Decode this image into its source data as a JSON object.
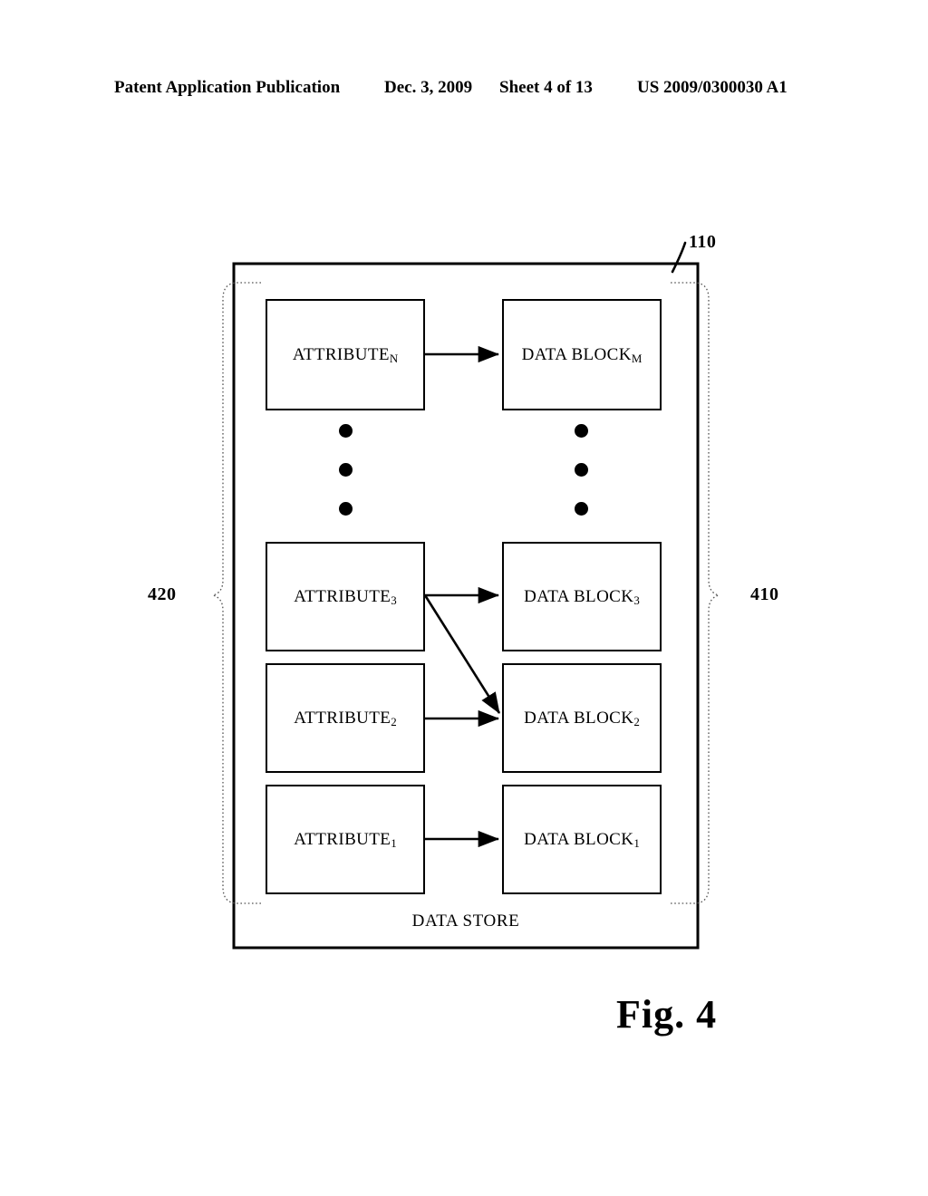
{
  "header": {
    "publication": "Patent Application Publication",
    "date": "Dec. 3, 2009",
    "sheet": "Sheet 4 of 13",
    "document_number": "US 2009/0300030 A1"
  },
  "figure": {
    "caption": "Fig. 4",
    "container_label": "DATA STORE",
    "references": {
      "container": "110",
      "left_group": "420",
      "right_group": "410"
    },
    "columns": {
      "left_heading": "ATTRIBUTE",
      "right_heading": "DATA BLOCK"
    },
    "attributes": [
      {
        "base": "ATTRIBUTE",
        "subscript": "N",
        "id": "attribute-n"
      },
      {
        "base": "ATTRIBUTE",
        "subscript": "3",
        "id": "attribute-3"
      },
      {
        "base": "ATTRIBUTE",
        "subscript": "2",
        "id": "attribute-2"
      },
      {
        "base": "ATTRIBUTE",
        "subscript": "1",
        "id": "attribute-1"
      }
    ],
    "data_blocks": [
      {
        "base": "DATA BLOCK",
        "subscript": "M",
        "id": "data-block-m"
      },
      {
        "base": "DATA BLOCK",
        "subscript": "3",
        "id": "data-block-3"
      },
      {
        "base": "DATA BLOCK",
        "subscript": "2",
        "id": "data-block-2"
      },
      {
        "base": "DATA BLOCK",
        "subscript": "1",
        "id": "data-block-1"
      }
    ],
    "connections": [
      {
        "from": "ATTRIBUTE_N",
        "to": "DATA BLOCK_M",
        "style": "horizontal-arrow"
      },
      {
        "from": "ATTRIBUTE_3",
        "to": "DATA BLOCK_3",
        "style": "horizontal-arrow"
      },
      {
        "from": "ATTRIBUTE_3",
        "to": "DATA BLOCK_2",
        "style": "diagonal-arrow"
      },
      {
        "from": "ATTRIBUTE_2",
        "to": "DATA BLOCK_2",
        "style": "horizontal-arrow"
      },
      {
        "from": "ATTRIBUTE_1",
        "to": "DATA BLOCK_1",
        "style": "horizontal-arrow"
      }
    ],
    "ellipsis": {
      "count": 3,
      "columns": 2
    },
    "colors": {
      "ink": "#000000",
      "paper": "#ffffff"
    }
  }
}
